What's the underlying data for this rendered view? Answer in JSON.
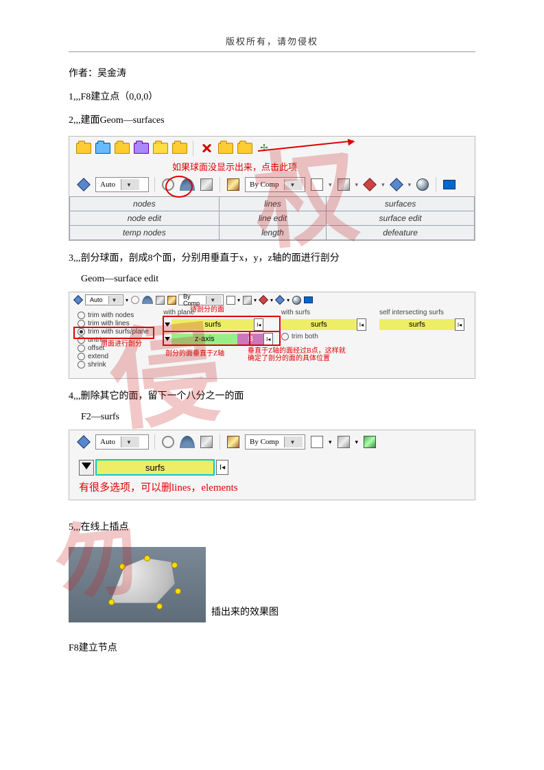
{
  "header": "版权所有，请勿侵权",
  "author_line": "作者：吴金涛",
  "step1": "1,,,F8建立点（0,0,0）",
  "step2": "2,,,建面Geom—surfaces",
  "panel1": {
    "auto": "Auto",
    "bycomp": "By Comp",
    "anno": "如果球面没显示出来，点击此项",
    "table": {
      "r1": {
        "c1": "nodes",
        "c2": "lines",
        "c3": "surfaces"
      },
      "r2": {
        "c1": "node edit",
        "c2": "line edit",
        "c3": "surface edit"
      },
      "r3": {
        "c1": "temp nodes",
        "c2": "length",
        "c3": "defeature"
      }
    }
  },
  "step3a": "3,,,剖分球面，剖成8个面，分别用垂直于x，y，z轴的面进行剖分",
  "step3b": "Geom—surface edit",
  "panel2": {
    "auto": "Auto",
    "bycomp": "By Comp",
    "radios": [
      "trim with nodes",
      "trim with lines",
      "trim with surfs/plane",
      "untrim",
      "offset",
      "extend",
      "shrink"
    ],
    "withplane": "with plane",
    "surfs": "surfs",
    "zaxis": "z-axis",
    "bval": "B",
    "withsurfs": "with surfs",
    "trimboth": "trim both",
    "selfint": "self intersecting surfs",
    "anno_top": "待剖分的面",
    "anno_left": "用面进行剖分",
    "anno_mid": "剖分的面垂直于Z轴",
    "anno_right": "垂直于Z轴的面经过B点，这样就确定了剖分的面的具体位置"
  },
  "step4a": "4,,,删除其它的面，留下一个八分之一的面",
  "step4b": "F2—surfs",
  "panel3": {
    "auto": "Auto",
    "bycomp": "By Comp",
    "surfs": "surfs",
    "anno": "有很多选项，可以删lines，elements"
  },
  "step5": "5,,,在线上插点",
  "fig5_caption": "插出来的效果图",
  "step6": "F8建立节点"
}
